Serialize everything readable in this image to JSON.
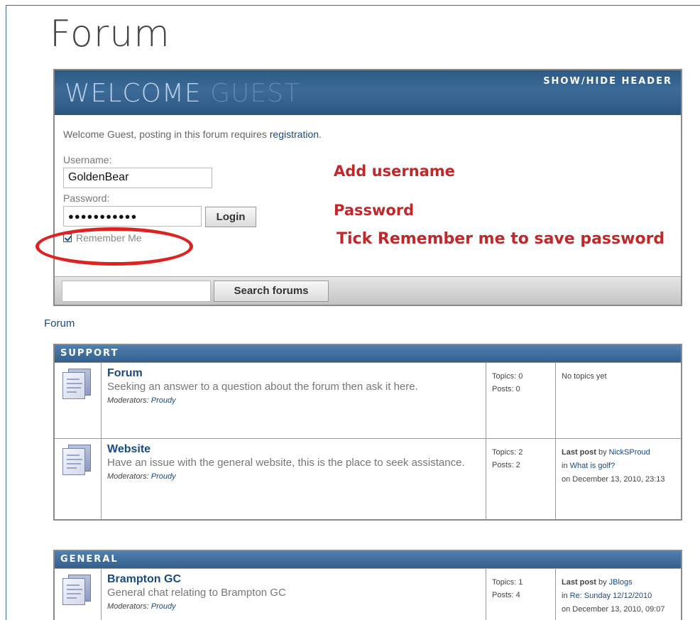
{
  "page": {
    "title": "Forum"
  },
  "welcome": {
    "title_part1": "WELCOME",
    "title_part2": "GUEST",
    "show_hide": "SHOW/HIDE HEADER",
    "intro_text": "Welcome Guest, posting in this forum requires",
    "intro_link": "registration",
    "intro_end": ".",
    "username_label": "Username:",
    "username_value": "GoldenBear",
    "password_label": "Password:",
    "password_value": "●●●●●●●●●●●",
    "login_button": "Login",
    "remember_label": "Remember Me",
    "remember_checked": true,
    "search_value": "",
    "search_button": "Search forums"
  },
  "annotations": {
    "username": "Add username",
    "password": "Password",
    "remember": "Tick Remember me to save password",
    "color": "#c0282a"
  },
  "breadcrumb": "Forum",
  "categories": [
    {
      "name": "SUPPORT",
      "boards": [
        {
          "name": "Forum",
          "desc": "Seeking an answer to a question about the forum then ask it here.",
          "mods_label": "Moderators:",
          "mods": "Proudy",
          "topics": "Topics: 0",
          "posts": "Posts: 0",
          "last_line1": "No topics yet",
          "last_by_label": "",
          "last_by": "",
          "last_in_label": "",
          "last_in": "",
          "last_on": ""
        },
        {
          "name": "Website",
          "desc": "Have an issue with the general website, this is the place to seek assistance.",
          "mods_label": "Moderators:",
          "mods": "Proudy",
          "topics": "Topics: 2",
          "posts": "Posts: 2",
          "last_line1": "Last post",
          "last_by_label": "by",
          "last_by": "NickSProud",
          "last_in_label": "in",
          "last_in": "What is golf?",
          "last_on": "on December 13, 2010, 23:13"
        }
      ]
    },
    {
      "name": "GENERAL",
      "boards": [
        {
          "name": "Brampton GC",
          "desc": "General chat relating to Brampton GC",
          "mods_label": "Moderators:",
          "mods": "Proudy",
          "topics": "Topics: 1",
          "posts": "Posts: 4",
          "last_line1": "Last post",
          "last_by_label": "by",
          "last_by": "JBlogs",
          "last_in_label": "in",
          "last_in": "Re: Sunday 12/12/2010",
          "last_on": "on December 13, 2010, 09:07"
        }
      ]
    }
  ]
}
